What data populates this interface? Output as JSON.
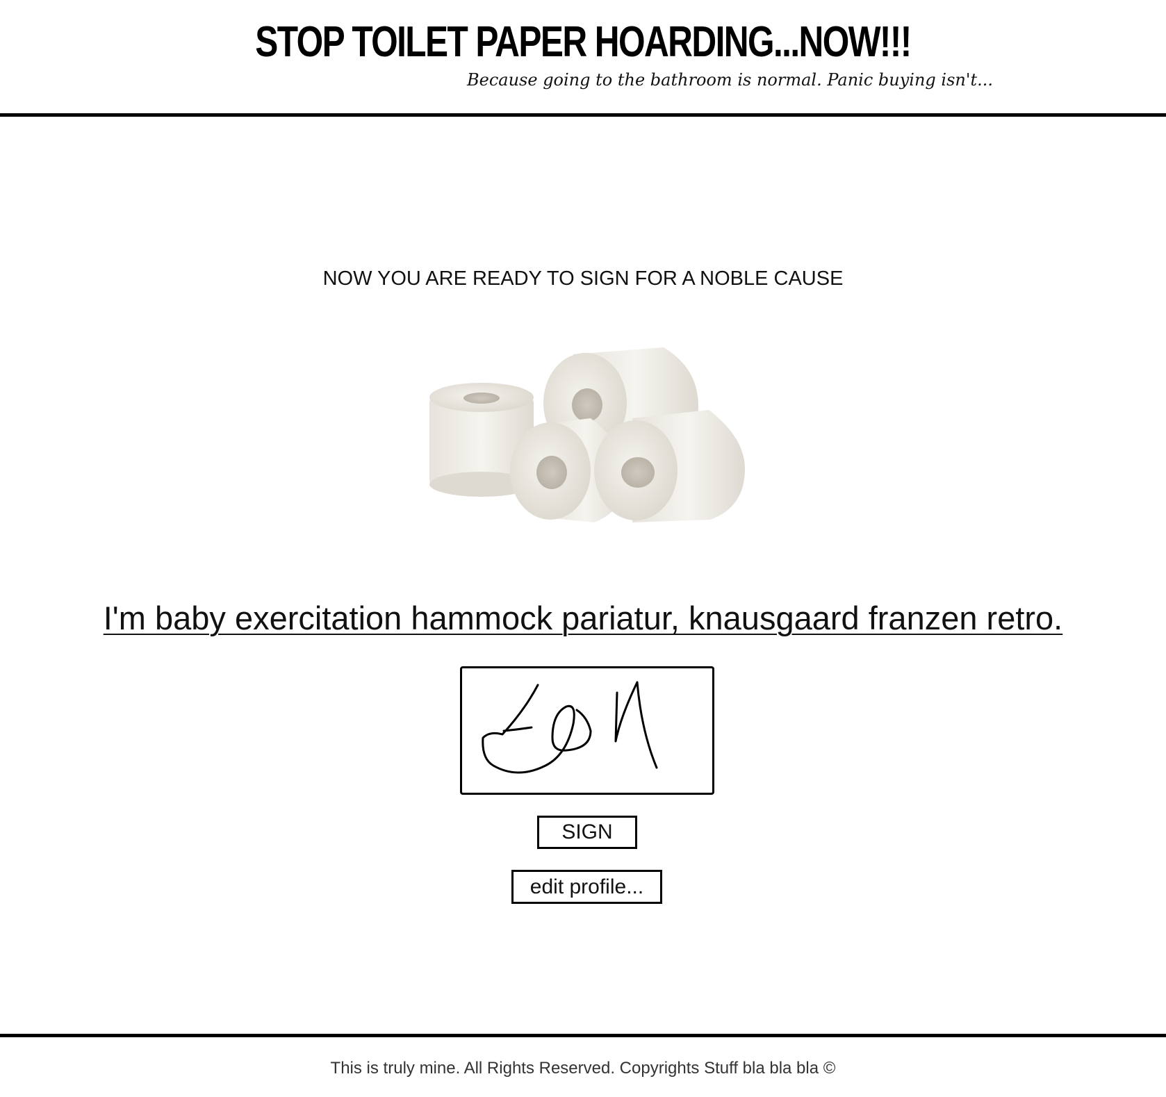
{
  "header": {
    "title": "STOP TOILET PAPER HOARDING...NOW!!!",
    "tagline": "Because going to the bathroom is normal. Panic buying isn't..."
  },
  "main": {
    "intro": "NOW YOU ARE READY TO SIGN FOR A NOBLE CAUSE",
    "image_icon": "toilet-paper-rolls-image",
    "statement": "I'm baby exercitation hammock pariatur, knausgaard franzen retro.",
    "sign_label": "SIGN",
    "edit_profile_label": "edit profile..."
  },
  "footer": {
    "text": "This is truly mine. All Rights Reserved. Copyrights Stuff bla bla bla ©"
  },
  "colors": {
    "border": "#000000",
    "text": "#111111",
    "background": "#ffffff"
  }
}
